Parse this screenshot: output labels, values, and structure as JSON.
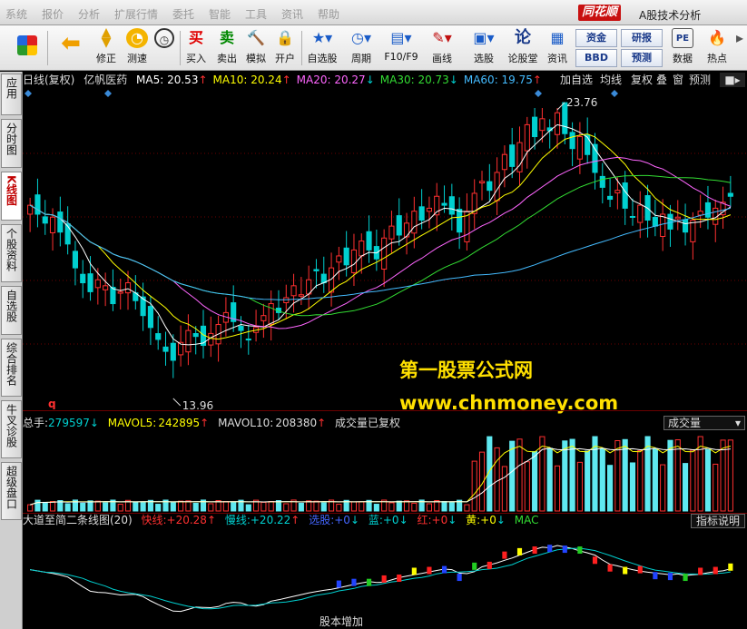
{
  "menu": {
    "items": [
      "系统",
      "报价",
      "分析",
      "扩展行情",
      "委托",
      "智能",
      "工具",
      "资讯",
      "帮助"
    ],
    "brand_logo": "同花顺",
    "brand_name": "A股技术分析"
  },
  "toolbar": {
    "buttons": [
      {
        "label": "",
        "icon": "grid-colorful-icon"
      },
      {
        "label": "",
        "icon": "back-arrow-icon"
      },
      {
        "label": "修正",
        "icon": "up-down-arrows-icon"
      },
      {
        "label": "测速",
        "icon": "speed-clock-icon"
      },
      {
        "label": "买入",
        "icon": "buy-icon",
        "glyph": "买"
      },
      {
        "label": "卖出",
        "icon": "sell-icon",
        "glyph": "卖"
      },
      {
        "label": "模拟",
        "icon": "hammer-icon"
      },
      {
        "label": "开户",
        "icon": "lock-icon"
      },
      {
        "label": "自选股",
        "icon": "star-list-icon"
      },
      {
        "label": "周期",
        "icon": "clock-cycle-icon"
      },
      {
        "label": "F10/F9",
        "icon": "document-icon"
      },
      {
        "label": "画线",
        "icon": "pen-icon"
      },
      {
        "label": "选股",
        "icon": "screen-select-icon"
      },
      {
        "label": "论股堂",
        "icon": "discuss-icon",
        "glyph": "论"
      },
      {
        "label": "资讯",
        "icon": "news-icon"
      },
      {
        "label": "数据",
        "icon": "pe-data-icon",
        "glyph": "PE"
      },
      {
        "label": "热点",
        "icon": "fire-icon"
      }
    ],
    "mini_buttons": [
      "资金",
      "研报",
      "BBD",
      "预测"
    ]
  },
  "sidebar": {
    "tabs": [
      {
        "label": "应用"
      },
      {
        "label": "分时图"
      },
      {
        "label": "K线图",
        "active": true
      },
      {
        "label": "个股资料"
      },
      {
        "label": "自选股"
      },
      {
        "label": "综合排名"
      },
      {
        "label": "牛叉诊股"
      },
      {
        "label": "超级盘口"
      }
    ]
  },
  "kline": {
    "period_label": "日线(复权)",
    "stock_name": "亿帆医药",
    "ma": [
      {
        "name": "MA5:",
        "value": "20.53",
        "dir": "↑",
        "color": "#ffffff"
      },
      {
        "name": "MA10:",
        "value": "20.24",
        "dir": "↑",
        "color": "#ffff00"
      },
      {
        "name": "MA20:",
        "value": "20.27",
        "dir": "↓",
        "color": "#ff66ff"
      },
      {
        "name": "MA30:",
        "value": "20.73",
        "dir": "↓",
        "color": "#33dd33"
      },
      {
        "name": "MA60:",
        "value": "19.75",
        "dir": "↑",
        "color": "#44bbff"
      }
    ],
    "tools": [
      "加自选",
      "均线",
      "复权",
      "叠",
      "窗",
      "预测"
    ],
    "high_label": "23.76",
    "low_label": "13.96",
    "event_marker": "q"
  },
  "volume": {
    "label": "总手:",
    "value": "279597",
    "value_dir": "↓",
    "mavol5_label": "MAVOL5:",
    "mavol5": "242895",
    "mavol5_dir": "↑",
    "mavol10_label": "MAVOL10:",
    "mavol10": "208380",
    "mavol10_dir": "↑",
    "note": "成交量已复权",
    "dropdown": "成交量"
  },
  "indicator": {
    "name": "大道至简二条线图(20)",
    "fast_label": "快线:",
    "fast": "+20.28",
    "fast_dir": "↑",
    "slow_label": "慢线:",
    "slow": "+20.22",
    "slow_dir": "↑",
    "pick_label": "选股:",
    "pick": "+0",
    "pick_dir": "↓",
    "blue_label": "蓝:",
    "blue": "+0",
    "blue_dir": "↓",
    "red_label": "红:",
    "red": "+0",
    "red_dir": "↓",
    "yellow_label": "黄:",
    "yellow": "+0",
    "yellow_dir": "↓",
    "mac": "MAC",
    "help_button": "指标说明",
    "event_label": "股本增加"
  },
  "watermark": {
    "line1": "第一股票公式网",
    "line2": "www.chnmoney.com"
  },
  "colors": {
    "up": "#ff3030",
    "down": "#00d0d0",
    "ma5": "#ffffff",
    "ma10": "#ffff00",
    "ma20": "#ff66ff",
    "ma30": "#33dd33",
    "ma60": "#44bbff",
    "grid": "#6b0000"
  },
  "chart_data": {
    "type": "candlestick",
    "description_series": "closing prices (approximate) used to render daily candles",
    "close": [
      20.5,
      20.2,
      19.9,
      20.1,
      19.6,
      19.2,
      18.4,
      17.9,
      17.6,
      18.0,
      17.8,
      17.2,
      17.6,
      17.9,
      17.3,
      16.8,
      16.4,
      16.0,
      15.6,
      15.3,
      15.9,
      16.3,
      16.1,
      15.8,
      16.2,
      16.5,
      16.9,
      16.6,
      16.3,
      16.0,
      16.4,
      16.8,
      17.2,
      16.9,
      17.4,
      17.8,
      17.5,
      18.0,
      18.3,
      17.9,
      18.4,
      18.8,
      18.5,
      19.0,
      19.3,
      19.0,
      18.7,
      19.4,
      19.8,
      19.5,
      19.9,
      20.3,
      20.0,
      20.4,
      20.8,
      20.5,
      20.2,
      19.6,
      20.3,
      20.9,
      21.3,
      21.0,
      21.6,
      22.2,
      21.8,
      22.6,
      23.2,
      22.8,
      23.4,
      23.0,
      23.6,
      22.9,
      22.4,
      22.8,
      22.2,
      21.6,
      21.1,
      20.7,
      21.0,
      20.4,
      20.1,
      20.5,
      20.0,
      19.8,
      20.2,
      19.7,
      20.1,
      19.6,
      20.0,
      20.3,
      20.1,
      20.4,
      20.6,
      20.8
    ],
    "high": 23.76,
    "low": 13.96,
    "ma": [
      "MA5",
      "MA10",
      "MA20",
      "MA30",
      "MA60"
    ]
  }
}
